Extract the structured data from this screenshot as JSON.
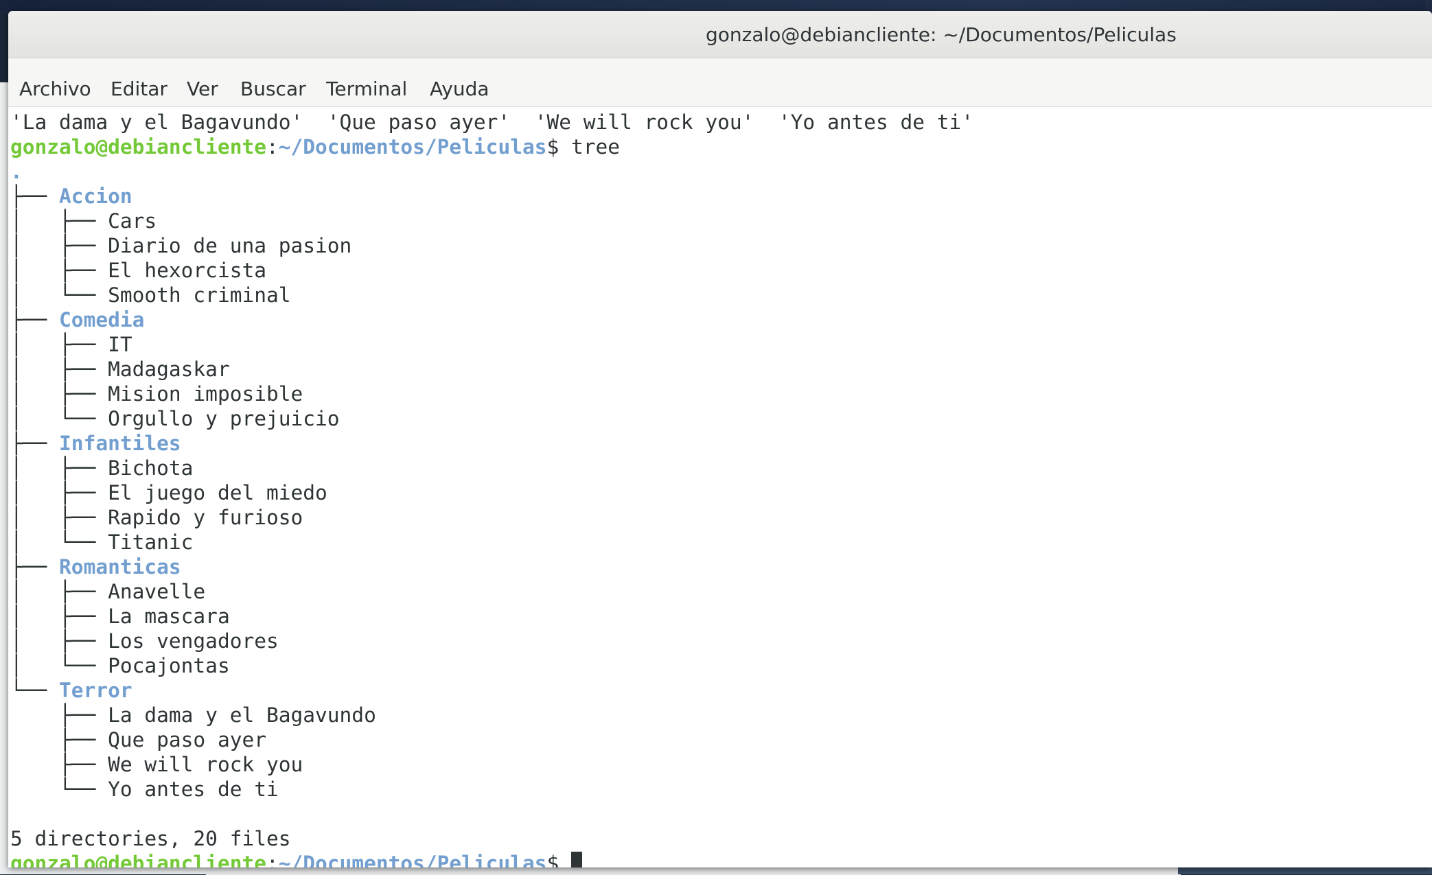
{
  "window": {
    "title": "gonzalo@debiancliente: ~/Documentos/Peliculas"
  },
  "menubar": {
    "items": [
      "Archivo",
      "Editar",
      "Ver",
      "Buscar",
      "Terminal",
      "Ayuda"
    ]
  },
  "terminal": {
    "ls_output": "'La dama y el Bagavundo'  'Que paso ayer'  'We will rock you'  'Yo antes de ti'",
    "prompt_user": "gonzalo@debiancliente",
    "prompt_sep": ":",
    "prompt_path": "~/Documentos/Peliculas",
    "prompt_symbol": "$",
    "command": " tree",
    "tree_root": ".",
    "tree": [
      {
        "prefix": "├── ",
        "name": "Accion",
        "files": [
          {
            "prefix": "│   ├── ",
            "name": "Cars"
          },
          {
            "prefix": "│   ├── ",
            "name": "Diario de una pasion"
          },
          {
            "prefix": "│   ├── ",
            "name": "El hexorcista"
          },
          {
            "prefix": "│   └── ",
            "name": "Smooth criminal"
          }
        ]
      },
      {
        "prefix": "├── ",
        "name": "Comedia",
        "files": [
          {
            "prefix": "│   ├── ",
            "name": "IT"
          },
          {
            "prefix": "│   ├── ",
            "name": "Madagaskar"
          },
          {
            "prefix": "│   ├── ",
            "name": "Mision imposible"
          },
          {
            "prefix": "│   └── ",
            "name": "Orgullo y prejuicio"
          }
        ]
      },
      {
        "prefix": "├── ",
        "name": "Infantiles",
        "files": [
          {
            "prefix": "│   ├── ",
            "name": "Bichota"
          },
          {
            "prefix": "│   ├── ",
            "name": "El juego del miedo"
          },
          {
            "prefix": "│   ├── ",
            "name": "Rapido y furioso"
          },
          {
            "prefix": "│   └── ",
            "name": "Titanic"
          }
        ]
      },
      {
        "prefix": "├── ",
        "name": "Romanticas",
        "files": [
          {
            "prefix": "│   ├── ",
            "name": "Anavelle"
          },
          {
            "prefix": "│   ├── ",
            "name": "La mascara"
          },
          {
            "prefix": "│   ├── ",
            "name": "Los vengadores"
          },
          {
            "prefix": "│   └── ",
            "name": "Pocajontas"
          }
        ]
      },
      {
        "prefix": "└── ",
        "name": "Terror",
        "files": [
          {
            "prefix": "    ├── ",
            "name": "La dama y el Bagavundo"
          },
          {
            "prefix": "    ├── ",
            "name": "Que paso ayer"
          },
          {
            "prefix": "    ├── ",
            "name": "We will rock you"
          },
          {
            "prefix": "    └── ",
            "name": "Yo antes de ti"
          }
        ]
      }
    ],
    "summary": "5 directories, 20 files",
    "colors": {
      "prompt_user": "#73c936",
      "prompt_path": "#729fcf",
      "directory": "#729fcf",
      "text": "#2e3436",
      "background": "#ffffff"
    }
  }
}
